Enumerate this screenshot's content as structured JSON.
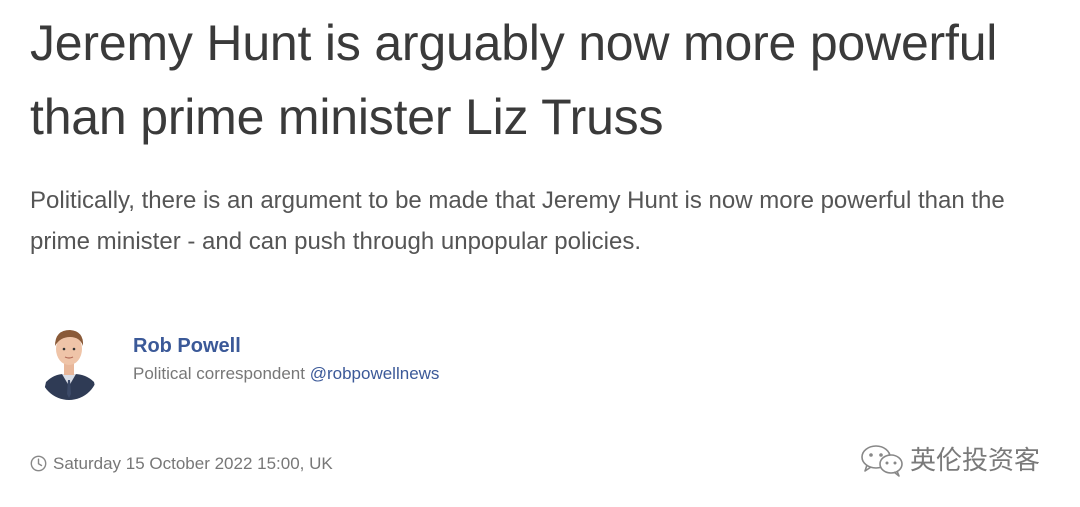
{
  "article": {
    "headline": "Jeremy Hunt is arguably now more powerful than prime minister Liz Truss",
    "standfirst": "Politically, there is an argument to be made that Jeremy Hunt is now more powerful than the prime minister - and can push through unpopular policies."
  },
  "author": {
    "name": "Rob Powell",
    "role": "Political correspondent",
    "handle": "@robpowellnews",
    "avatar_icon": "author-photo"
  },
  "meta": {
    "timestamp": "Saturday 15 October 2022 15:00, UK",
    "clock_icon": "clock-icon"
  },
  "watermark": {
    "text": "英伦投资客",
    "icon": "wechat-icon"
  },
  "colors": {
    "headline": "#3a3a3a",
    "body_text": "#555555",
    "link": "#3b5998",
    "muted": "#777777"
  }
}
